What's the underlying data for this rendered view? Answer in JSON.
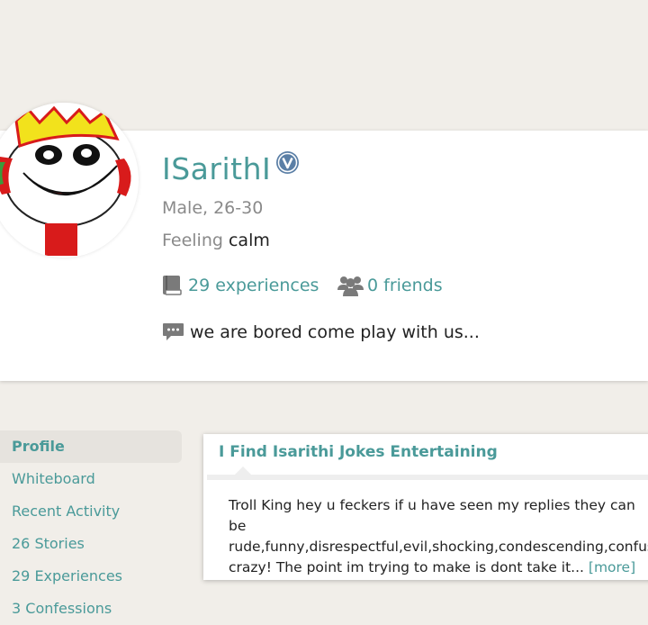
{
  "profile": {
    "username": "ISarithI",
    "gender_age": "Male, 26-30",
    "feeling_label": "Feeling",
    "feeling_value": "calm",
    "experiences": "29 experiences",
    "friends": "0 friends",
    "status": "we are bored come play with us..."
  },
  "sidebar": {
    "items": [
      {
        "label": "Profile"
      },
      {
        "label": "Whiteboard"
      },
      {
        "label": "Recent Activity"
      },
      {
        "label": "26 Stories"
      },
      {
        "label": "29 Experiences"
      },
      {
        "label": "3 Confessions"
      }
    ]
  },
  "story": {
    "title": "I Find Isarithi Jokes Entertaining",
    "body": "Troll King hey u feckers if u have seen my replies they can be\nrude,funny,disrespectful,evil,shocking,condescending,confusing,\ncrazy! The point im trying to make is dont take it... ",
    "more": "[more]"
  },
  "colors": {
    "accent": "#4a9a99",
    "background": "#f1eee9",
    "verified_badge": "#5b7fa6"
  },
  "icons": {
    "verified": "verified-badge-icon",
    "experiences": "book-icon",
    "friends": "group-icon",
    "status": "speech-bubble-icon"
  }
}
